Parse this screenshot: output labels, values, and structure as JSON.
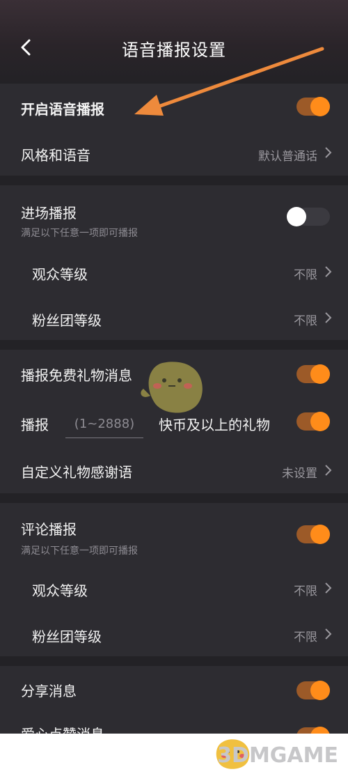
{
  "header": {
    "title": "语音播报设置"
  },
  "section1": {
    "enable_label": "开启语音播报",
    "style_label": "风格和语音",
    "style_value": "默认普通话"
  },
  "section2": {
    "entry_label": "进场播报",
    "entry_hint": "满足以下任意一项即可播报",
    "audience_label": "观众等级",
    "audience_value": "不限",
    "fans_label": "粉丝团等级",
    "fans_value": "不限"
  },
  "section3": {
    "free_gift_label": "播报免费礼物消息",
    "broadcast_prefix": "播报",
    "amount_placeholder": "(1~2888)",
    "broadcast_suffix": "快币及以上的礼物",
    "thanks_label": "自定义礼物感谢语",
    "thanks_value": "未设置"
  },
  "section4": {
    "comment_label": "评论播报",
    "comment_hint": "满足以下任意一项即可播报",
    "audience_label": "观众等级",
    "audience_value": "不限",
    "fans_label": "粉丝团等级",
    "fans_value": "不限"
  },
  "section5": {
    "share_label": "分享消息",
    "like_label": "爱心点赞消息"
  },
  "watermark": {
    "text": "3DMGAME"
  },
  "toggles": {
    "enable_voice": true,
    "entry_broadcast": false,
    "free_gift": true,
    "gift_threshold": true,
    "comment_broadcast": true,
    "share_message": true,
    "like_message": true
  },
  "colors": {
    "accent": "#ff8c1a",
    "track_on": "#9c5a28",
    "background": "#232226",
    "section": "#2d2c31",
    "arrow": "#ee8a3c"
  }
}
